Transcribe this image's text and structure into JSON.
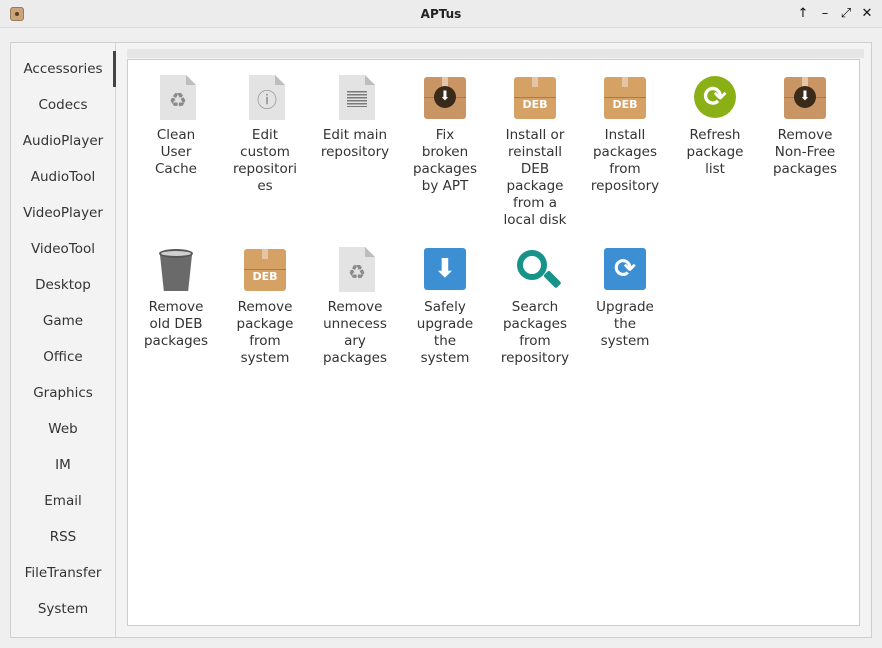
{
  "window": {
    "title": "APTus",
    "controls": [
      "↑",
      "–",
      "⤢",
      "✕"
    ]
  },
  "sidebar": {
    "items": [
      {
        "label": "Accessories",
        "active": true
      },
      {
        "label": "Codecs"
      },
      {
        "label": "AudioPlayer"
      },
      {
        "label": "AudioTool"
      },
      {
        "label": "VideoPlayer"
      },
      {
        "label": "VideoTool"
      },
      {
        "label": "Desktop"
      },
      {
        "label": "Game"
      },
      {
        "label": "Office"
      },
      {
        "label": "Graphics"
      },
      {
        "label": "Web"
      },
      {
        "label": "IM"
      },
      {
        "label": "Email"
      },
      {
        "label": "RSS"
      },
      {
        "label": "FileTransfer"
      },
      {
        "label": "System"
      }
    ]
  },
  "tools": [
    {
      "label": "Clean\nUser\nCache",
      "icon": "recycle-file-icon"
    },
    {
      "label": "Edit\ncustom\nrepositori\nes",
      "icon": "info-file-icon"
    },
    {
      "label": "Edit main\nrepository",
      "icon": "text-file-icon"
    },
    {
      "label": "Fix\nbroken\npackages\nby APT",
      "icon": "package-download-icon"
    },
    {
      "label": "Install or\nreinstall\nDEB\npackage\nfrom a\nlocal disk",
      "icon": "deb-package-icon",
      "icon_text": "DEB"
    },
    {
      "label": "Install\npackages\nfrom\nrepository",
      "icon": "deb-package-icon",
      "icon_text": "DEB"
    },
    {
      "label": "Refresh\npackage\nlist",
      "icon": "refresh-icon"
    },
    {
      "label": "Remove\nNon-Free\npackages",
      "icon": "package-download-icon"
    },
    {
      "label": "Remove\nold DEB\npackages",
      "icon": "trash-icon"
    },
    {
      "label": "Remove\npackage\nfrom\nsystem",
      "icon": "deb-package-icon",
      "icon_text": "DEB"
    },
    {
      "label": "Remove\nunnecess\nary\npackages",
      "icon": "recycle-file-icon"
    },
    {
      "label": "Safely\nupgrade\nthe\nsystem",
      "icon": "download-arrow-icon"
    },
    {
      "label": "Search\npackages\nfrom\nrepository",
      "icon": "search-icon"
    },
    {
      "label": "Upgrade\nthe\nsystem",
      "icon": "sync-icon"
    }
  ],
  "glyphs": {
    "recycle": "♻",
    "info": "ⓘ",
    "down": "⬇",
    "refresh": "⟳",
    "sync": "⟳"
  },
  "colors": {
    "package": "#c99565",
    "deb": "#d6a165",
    "refresh": "#8bb016",
    "blue": "#3d8fd4",
    "teal": "#18938a"
  }
}
